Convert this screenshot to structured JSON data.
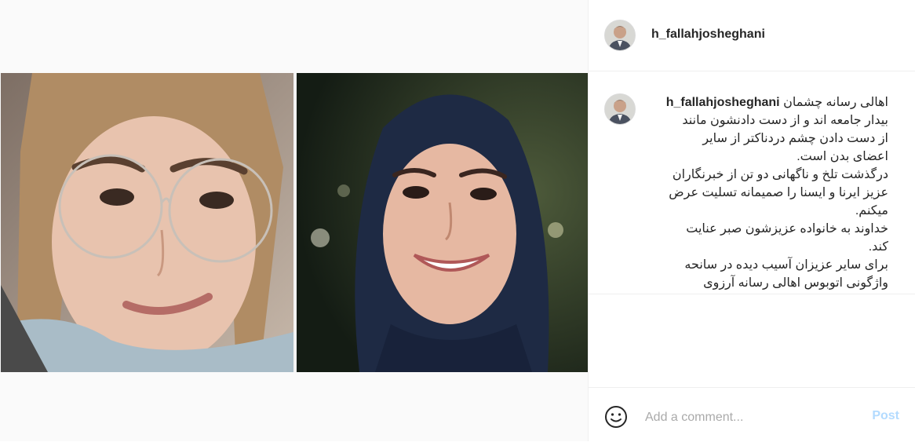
{
  "post": {
    "username": "h_fallahjosheghani",
    "caption_lines": [
      "اهالی رسانه چشمان",
      "بیدار جامعه اند و از دست دادنشون مانند",
      "از دست دادن چشم دردناکتر از سایر",
      "اعضای بدن است.",
      "درگذشت تلخ و ناگهانی دو تن از خبرنگاران",
      "عزیز ایرنا و ایسنا را صمیمانه تسلیت عرض",
      "میکنم.",
      "خداوند به خانواده عزیزشون صبر عنایت",
      "کند.",
      "برای سایر عزیزان آسیب دیده در سانحه",
      "واژگونی اتوبوس اهالی رسانه آرزوی"
    ]
  },
  "comment_box": {
    "placeholder": "Add a comment...",
    "post_label": "Post"
  },
  "icons": {
    "emoji": "smiley-icon"
  },
  "colors": {
    "post_button": "#b3dbff",
    "username": "#262626",
    "border": "#efefef"
  }
}
